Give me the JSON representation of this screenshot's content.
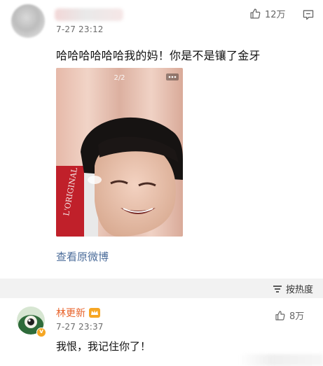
{
  "top_comment": {
    "time": "7-27 23:12",
    "likes": "12万",
    "text": "哈哈哈哈哈哈我的妈！你是不是镶了金牙",
    "photo": {
      "counter": "2/2"
    },
    "view_original": "查看原微博"
  },
  "sort": {
    "label": "按热度"
  },
  "reply": {
    "name": "林更新",
    "time": "7-27 23:37",
    "likes": "8万",
    "text": "我恨，我记住你了！"
  },
  "colors": {
    "link": "#4b6c9a",
    "username": "#e8632b",
    "background_gray": "#f2f2f2"
  },
  "icons": [
    "thumbs-up-icon",
    "comment-icon",
    "more-icon",
    "sort-icon",
    "crown-icon",
    "verified-badge-icon"
  ]
}
